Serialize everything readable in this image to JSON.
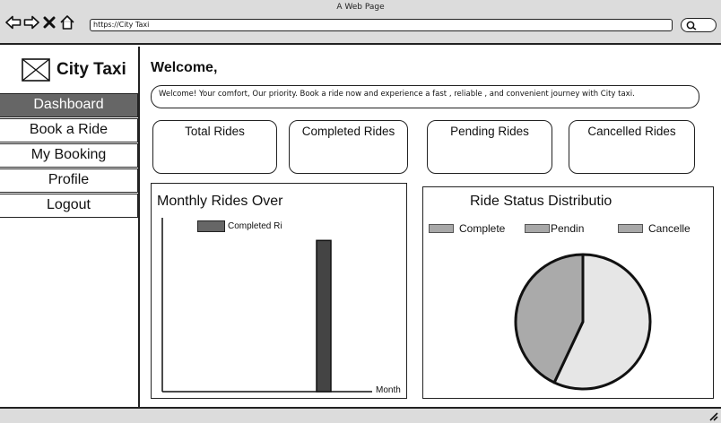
{
  "browser": {
    "window_title": "A Web Page",
    "url": "https://City Taxi",
    "icons": [
      "back-arrow-icon",
      "forward-arrow-icon",
      "close-icon",
      "home-icon",
      "search-icon"
    ]
  },
  "sidebar": {
    "logo_text": "City Taxi",
    "items": [
      {
        "label": "Dashboard",
        "active": true
      },
      {
        "label": "Book a Ride",
        "active": false
      },
      {
        "label": "My Booking",
        "active": false
      },
      {
        "label": "Profile",
        "active": false
      },
      {
        "label": "Logout",
        "active": false
      }
    ]
  },
  "main": {
    "welcome_title": "Welcome,",
    "welcome_message": "Welcome! Your comfort, Our priority. Book a ride now and experience a fast , reliable , and convenient journey with City taxi.",
    "cards": [
      {
        "label": "Total Rides"
      },
      {
        "label": "Completed Rides"
      },
      {
        "label": "Pending Rides"
      },
      {
        "label": "Cancelled Rides"
      }
    ]
  },
  "bar_panel": {
    "title": "Monthly Rides Over",
    "legend_label": "Completed Ri",
    "x_label": "Month"
  },
  "pie_panel": {
    "title": "Ride Status  Distributio",
    "legend": [
      {
        "label": "Complete"
      },
      {
        "label": "Pendin"
      },
      {
        "label": "Cancelle"
      }
    ]
  },
  "colors": {
    "active_menu": "#666666",
    "bar_fill": "#444444",
    "pie_light": "#e6e6e6",
    "pie_dark": "#aaaaaa",
    "legend_swatch": "#a8a8a8"
  },
  "chart_data": [
    {
      "type": "bar",
      "title": "Monthly Rides Over",
      "xlabel": "Month",
      "ylabel": "",
      "categories": [],
      "series": [
        {
          "name": "Completed Ri",
          "values": [
            1
          ]
        }
      ],
      "ylim": [
        0,
        1.15
      ],
      "grid": false,
      "legend": "top-left"
    },
    {
      "type": "pie",
      "title": "Ride Status  Distributio",
      "labels": [
        "Complete",
        "Pendin",
        "Cancelle"
      ],
      "values": [
        57,
        43,
        0
      ],
      "legend": "top"
    }
  ]
}
